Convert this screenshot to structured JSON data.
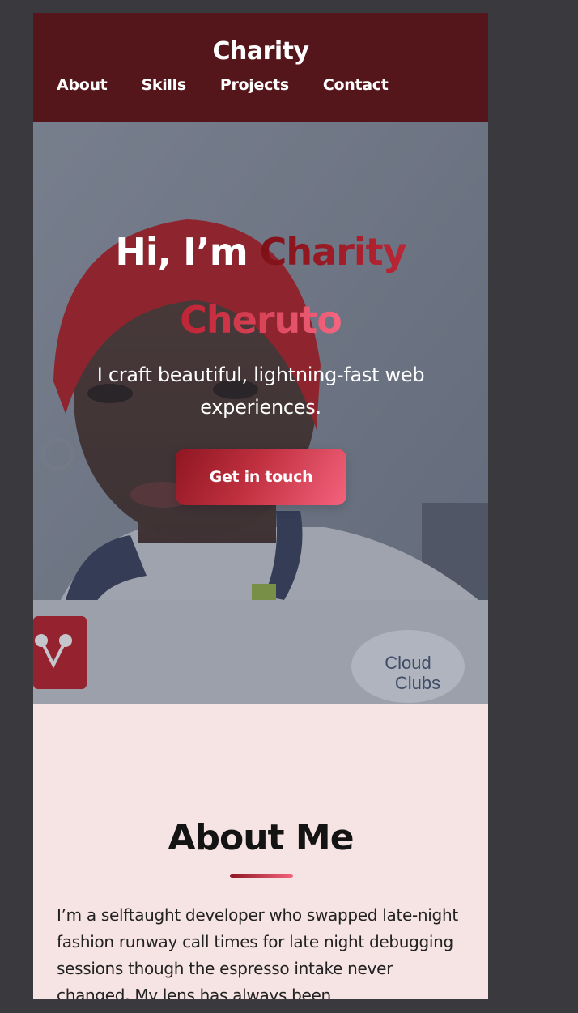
{
  "header": {
    "brand": "Charity",
    "nav": [
      "About",
      "Skills",
      "Projects",
      "Contact"
    ]
  },
  "hero": {
    "greeting": "Hi, I’m",
    "name": "Charity Cheruto",
    "tagline": "I craft beautiful, lightning-fast web experiences.",
    "cta_label": "Get in touch",
    "photo_badge": "Cloud Clubs"
  },
  "about": {
    "title": "About Me",
    "text": "I’m a selftaught developer who swapped late-night fashion runway call times for late night debugging sessions though the espresso intake never changed. My lens has always been"
  },
  "colors": {
    "header_bg": "#55161b",
    "accent_dark": "#8f1622",
    "accent_light": "#f4637d",
    "about_bg": "#f6e3e3",
    "page_bg": "#3a3a3e"
  }
}
